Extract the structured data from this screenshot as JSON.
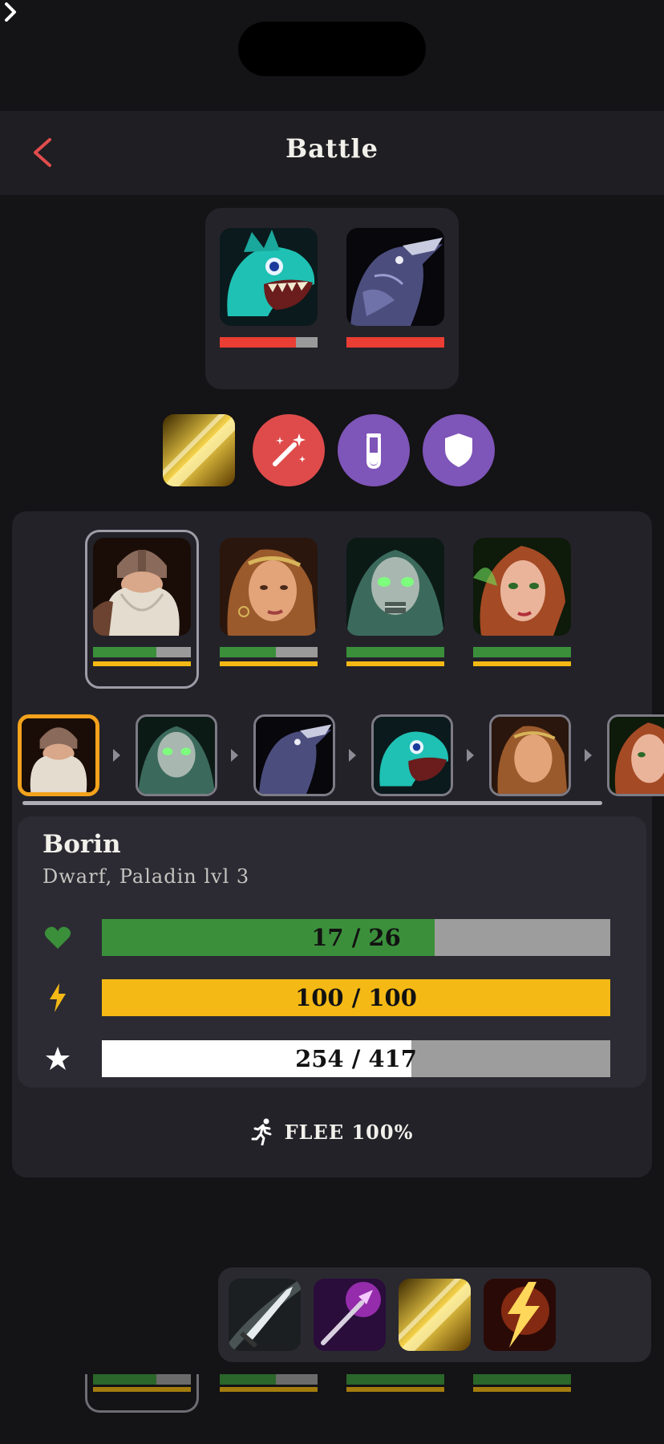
{
  "header": {
    "title": "Battle"
  },
  "enemies": [
    {
      "name": "sea-serpent",
      "hp_fraction": 0.78
    },
    {
      "name": "raven",
      "hp_fraction": 1.0
    }
  ],
  "actions": [
    {
      "name": "slash-skill"
    },
    {
      "name": "magic-wand"
    },
    {
      "name": "potion"
    },
    {
      "name": "defend-shield"
    }
  ],
  "party": [
    {
      "name": "dwarf-paladin",
      "hp_fraction": 0.65,
      "selected": true
    },
    {
      "name": "elf-woman",
      "hp_fraction": 0.57
    },
    {
      "name": "undead-warrior",
      "hp_fraction": 1.0
    },
    {
      "name": "green-elf",
      "hp_fraction": 1.0
    }
  ],
  "turn_order": [
    "dwarf-paladin",
    "undead-warrior",
    "raven",
    "sea-serpent",
    "elf-woman",
    "green-elf"
  ],
  "selected": {
    "name": "Borin",
    "subtitle": "Dwarf, Paladin lvl 3",
    "hp_text": "17 / 26",
    "hp_fraction": 0.654,
    "energy_text": "100 / 100",
    "energy_fraction": 1.0,
    "xp_text": "254 / 417",
    "xp_fraction": 0.609
  },
  "flee": {
    "label": "FLEE 100%"
  },
  "colors": {
    "hp": "#3b8f3b",
    "energy": "#f4b915",
    "xp": "#ffffff",
    "enemy_hp": "#ea3d33",
    "potion": "#7e55b8",
    "wand": "#df4b4b",
    "turn_active": "#f3a21c"
  }
}
